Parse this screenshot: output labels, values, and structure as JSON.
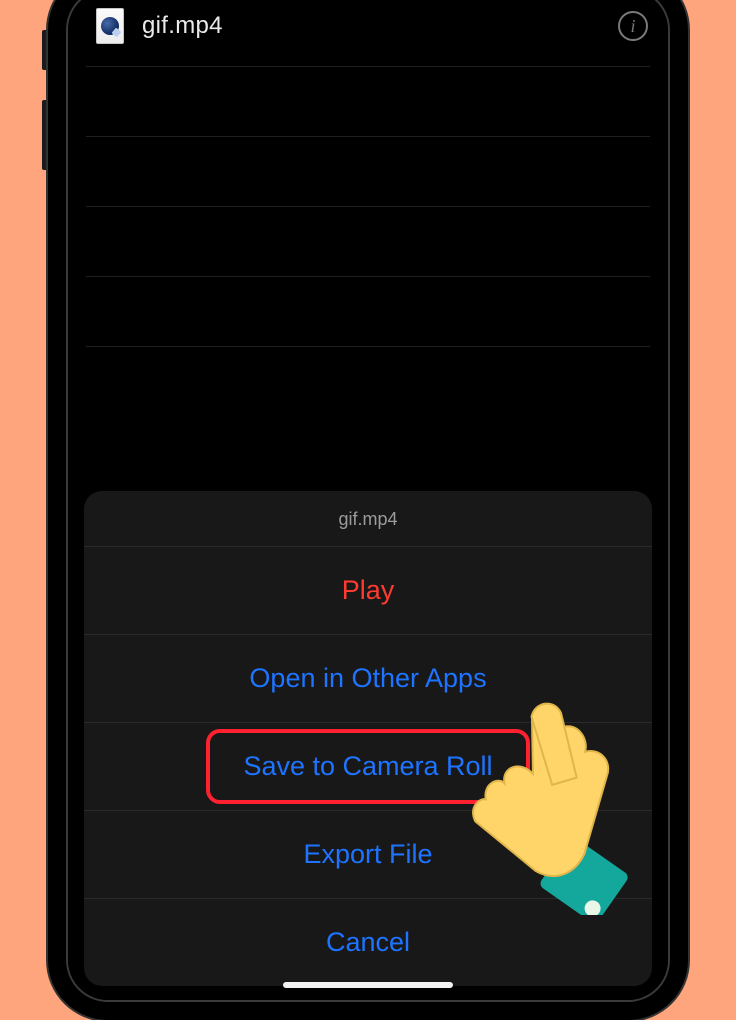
{
  "file": {
    "name": "gif.mp4"
  },
  "sheet": {
    "title": "gif.mp4",
    "items": {
      "play": "Play",
      "open": "Open in Other Apps",
      "save": "Save to Camera Roll",
      "export": "Export File",
      "cancel": "Cancel"
    }
  },
  "annotation": {
    "highlighted_action": "Save to Camera Roll"
  }
}
